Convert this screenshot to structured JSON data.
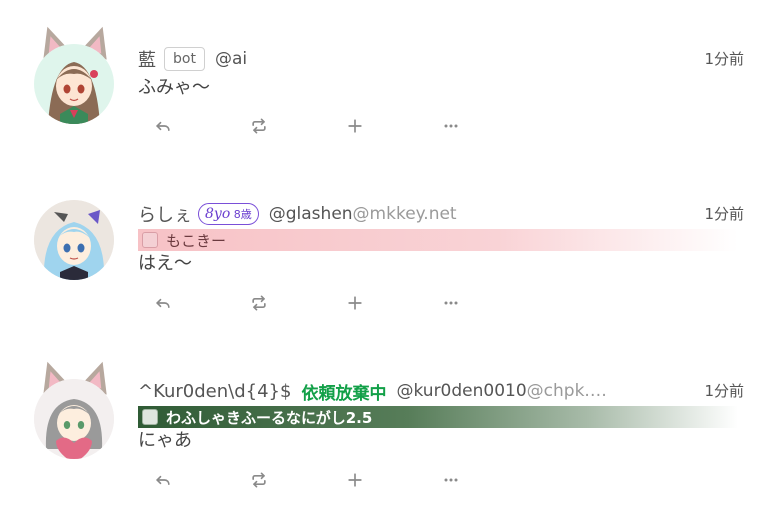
{
  "notes": [
    {
      "name": "藍",
      "badge": "bot",
      "acct": "@ai",
      "host": "",
      "time": "1分前",
      "text": "ふみゃ〜",
      "icon": "avatar-ai"
    },
    {
      "name": "らしぇ",
      "age_badge_big": "8yo",
      "age_badge_small": "8歳",
      "acct": "@glashen",
      "host": "@mkkey.net",
      "time": "1分前",
      "instance": "もこきー",
      "text": "はえ〜",
      "icon": "avatar-rashe"
    },
    {
      "name": "^Kur0den\\d{4}$",
      "status": "依頼放棄中",
      "acct": "@kur0den0010",
      "host": "@chpk.…",
      "time": "1分前",
      "instance": "わふしゃきふーるなにがし2.5",
      "text": "にゃあ",
      "icon": "avatar-kur0den"
    }
  ],
  "actions": {
    "reply": "reply-icon",
    "renote": "renote-icon",
    "react": "plus-icon",
    "more": "more-icon"
  },
  "colors": {
    "status_green": "#12a048",
    "instance_pink": "#f7c2c6",
    "instance_green": "#2f5b35",
    "age_badge": "#7a4fd8"
  }
}
